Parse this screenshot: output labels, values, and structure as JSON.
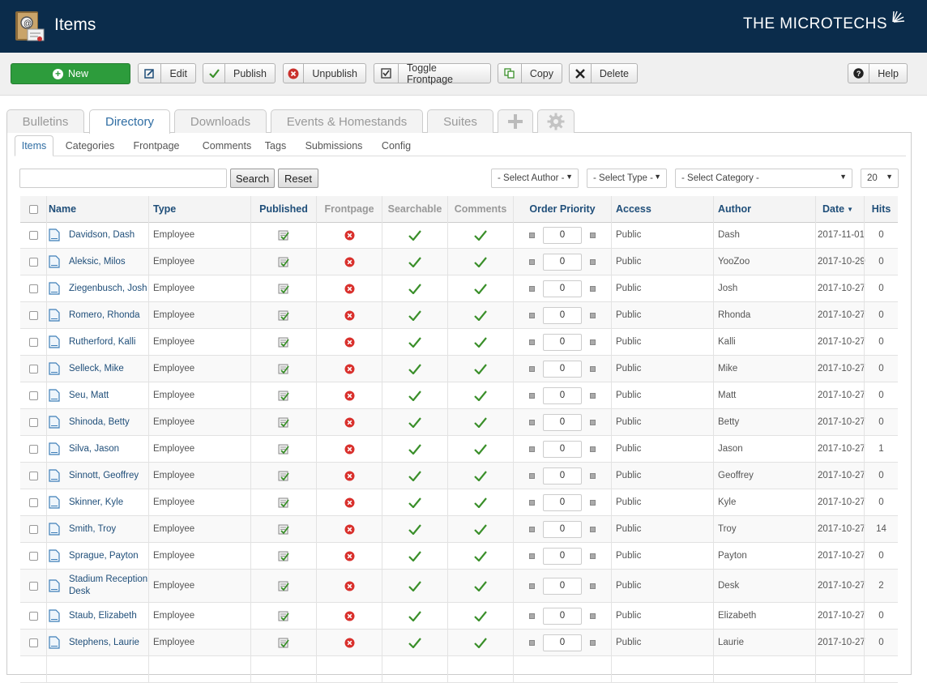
{
  "header": {
    "title": "Items",
    "brand": "THE MICROTECHS"
  },
  "toolbar": {
    "new": "New",
    "edit": "Edit",
    "publish": "Publish",
    "unpublish": "Unpublish",
    "toggle_frontpage": "Toggle Frontpage",
    "copy": "Copy",
    "delete": "Delete",
    "help": "Help"
  },
  "main_tabs": [
    "Bulletins",
    "Directory",
    "Downloads",
    "Events & Homestands",
    "Suites"
  ],
  "sub_tabs": [
    "Items",
    "Categories",
    "Frontpage",
    "Comments",
    "Tags",
    "Submissions",
    "Config"
  ],
  "filters": {
    "search_value": "",
    "search_button": "Search",
    "reset_button": "Reset",
    "author": "- Select Author -",
    "type": "- Select Type -",
    "category": "- Select Category -",
    "limit": "20"
  },
  "columns": {
    "name": "Name",
    "type": "Type",
    "published": "Published",
    "frontpage": "Frontpage",
    "searchable": "Searchable",
    "comments": "Comments",
    "order": "Order Priority",
    "access": "Access",
    "author": "Author",
    "date": "Date",
    "hits": "Hits"
  },
  "rows": [
    {
      "name": "Davidson, Dash",
      "type": "Employee",
      "order": "0",
      "access": "Public",
      "author": "Dash",
      "date": "2017-11-01",
      "hits": "0"
    },
    {
      "name": "Aleksic, Milos",
      "type": "Employee",
      "order": "0",
      "access": "Public",
      "author": "YooZoo",
      "date": "2017-10-29",
      "hits": "0"
    },
    {
      "name": "Ziegenbusch, Josh",
      "type": "Employee",
      "order": "0",
      "access": "Public",
      "author": "Josh",
      "date": "2017-10-27",
      "hits": "0"
    },
    {
      "name": "Romero, Rhonda",
      "type": "Employee",
      "order": "0",
      "access": "Public",
      "author": "Rhonda",
      "date": "2017-10-27",
      "hits": "0"
    },
    {
      "name": "Rutherford, Kalli",
      "type": "Employee",
      "order": "0",
      "access": "Public",
      "author": "Kalli",
      "date": "2017-10-27",
      "hits": "0"
    },
    {
      "name": "Selleck, Mike",
      "type": "Employee",
      "order": "0",
      "access": "Public",
      "author": "Mike",
      "date": "2017-10-27",
      "hits": "0"
    },
    {
      "name": "Seu, Matt",
      "type": "Employee",
      "order": "0",
      "access": "Public",
      "author": "Matt",
      "date": "2017-10-27",
      "hits": "0"
    },
    {
      "name": "Shinoda, Betty",
      "type": "Employee",
      "order": "0",
      "access": "Public",
      "author": "Betty",
      "date": "2017-10-27",
      "hits": "0"
    },
    {
      "name": "Silva, Jason",
      "type": "Employee",
      "order": "0",
      "access": "Public",
      "author": "Jason",
      "date": "2017-10-27",
      "hits": "1"
    },
    {
      "name": "Sinnott, Geoffrey",
      "type": "Employee",
      "order": "0",
      "access": "Public",
      "author": "Geoffrey",
      "date": "2017-10-27",
      "hits": "0"
    },
    {
      "name": "Skinner, Kyle",
      "type": "Employee",
      "order": "0",
      "access": "Public",
      "author": "Kyle",
      "date": "2017-10-27",
      "hits": "0"
    },
    {
      "name": "Smith, Troy",
      "type": "Employee",
      "order": "0",
      "access": "Public",
      "author": "Troy",
      "date": "2017-10-27",
      "hits": "14"
    },
    {
      "name": "Sprague, Payton",
      "type": "Employee",
      "order": "0",
      "access": "Public",
      "author": "Payton",
      "date": "2017-10-27",
      "hits": "0"
    },
    {
      "name": "Stadium Reception Desk",
      "type": "Employee",
      "order": "0",
      "access": "Public",
      "author": "Desk",
      "date": "2017-10-27",
      "hits": "2"
    },
    {
      "name": "Staub, Elizabeth",
      "type": "Employee",
      "order": "0",
      "access": "Public",
      "author": "Elizabeth",
      "date": "2017-10-27",
      "hits": "0"
    },
    {
      "name": "Stephens, Laurie",
      "type": "Employee",
      "order": "0",
      "access": "Public",
      "author": "Laurie",
      "date": "2017-10-27",
      "hits": "0"
    }
  ],
  "colors": {
    "header_bg": "#0b2c4b",
    "new_button": "#2d9c3c",
    "link": "#1f4e79",
    "unpublished_red": "#d9302c",
    "check_green": "#3a8f2a"
  }
}
